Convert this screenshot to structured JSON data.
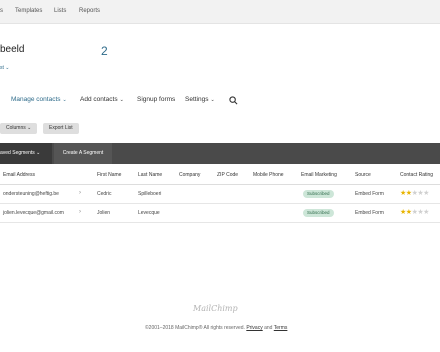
{
  "top_nav": [
    "s",
    "Templates",
    "Lists",
    "Reports"
  ],
  "list": {
    "name": "beeld",
    "count": "2",
    "sublink": "st ⌄"
  },
  "menu": [
    {
      "label": "Manage contacts",
      "dropdown": true,
      "active": true
    },
    {
      "label": "Add contacts",
      "dropdown": true,
      "active": false
    },
    {
      "label": "Signup forms",
      "dropdown": false,
      "active": false
    },
    {
      "label": "Settings",
      "dropdown": true,
      "active": false
    }
  ],
  "search_icon": "search-icon",
  "buttons": {
    "columns": "Columns ⌄",
    "export": "Export List"
  },
  "segments": {
    "saved": "aved Segments ⌄",
    "create": "Create A Segment"
  },
  "table": {
    "headers": [
      "Email Address",
      "First Name",
      "Last Name",
      "Company",
      "ZIP Code",
      "Mobile Phone",
      "Email Marketing",
      "Source",
      "Contact Rating"
    ],
    "rows": [
      {
        "email": "ondersteuning@heftig.be",
        "first": "Cedric",
        "last": "Spilleboeri",
        "status": "Subscribed",
        "source": "Embed Form",
        "rating": 2
      },
      {
        "email": "jolien.levecque@gmail.com",
        "first": "Jolien",
        "last": "Levecque",
        "status": "Subscribed",
        "source": "Embed Form",
        "rating": 2
      }
    ]
  },
  "footer": {
    "logo": "MailChimp",
    "copyright": "©2001–2018 MailChimp® All rights reserved.",
    "privacy": "Privacy",
    "and": "and",
    "terms": "Terms"
  },
  "colors": {
    "accent": "#2e6b8a",
    "segment_bar": "#4a4a4a",
    "badge_bg": "#cde6d8",
    "star": "#e8b400"
  }
}
